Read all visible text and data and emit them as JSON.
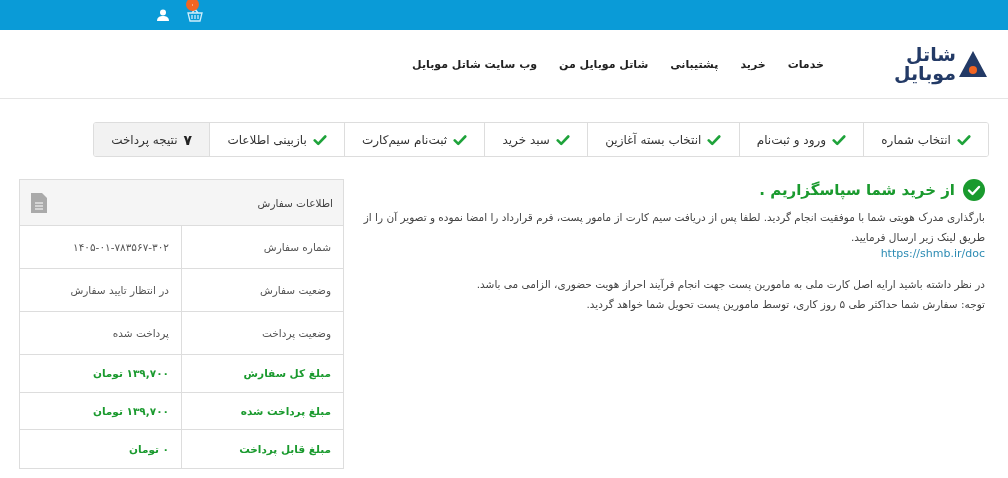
{
  "topbar": {
    "cart_count": "۰"
  },
  "header": {
    "logo": {
      "line_1": "شاتل",
      "line_2": "موبایل"
    },
    "nav": [
      "خدمات",
      "خرید",
      "پشتیبانی",
      "شاتل موبایل من",
      "وب سایت شاتل موبایل"
    ]
  },
  "steps": [
    {
      "label": "انتخاب شماره",
      "completed": true,
      "selected": false
    },
    {
      "label": "ورود و ثبت‌نام",
      "completed": true,
      "selected": false
    },
    {
      "label": "انتخاب بسته آغازین",
      "completed": true,
      "selected": false
    },
    {
      "label": "سبد خرید",
      "completed": true,
      "selected": false
    },
    {
      "label": "ثبت‌نام سیم‌کارت",
      "completed": true,
      "selected": false
    },
    {
      "label": "بازبینی اطلاعات",
      "completed": true,
      "selected": false
    },
    {
      "label": "نتیجه پرداخت",
      "number": "۷",
      "completed": false,
      "selected": true
    }
  ],
  "message": {
    "title": "از خرید شما سپاسگزاریم .",
    "paragraph_1": "بارگذاری مدرک هویتی شما با موفقیت انجام گردید. لطفا پس از دریافت سیم کارت از مامور پست، فرم قرارداد را امضا نموده و تصویر آن را از طریق لینک زیر ارسال فرمایید.",
    "link": "https://shmb.ir/doc",
    "paragraph_2": "در نظر داشته باشید ارایه اصل کارت ملی به مامورین پست جهت انجام فرآیند احراز هویت حضوری، الزامی می باشد.",
    "paragraph_3": "توجه: سفارش شما حداکثر طی ۵ روز کاری، توسط مامورین پست تحویل شما خواهد گردید."
  },
  "order_info": {
    "title": "اطلاعات سفارش",
    "rows": [
      {
        "label": "شماره سفارش",
        "value": "۱۴۰۵-۰۱-۷۸۳۵۶۷-۳۰۲",
        "highlighted": false
      },
      {
        "label": "وضعیت سفارش",
        "value": "در انتظار تایید سفارش",
        "highlighted": false
      },
      {
        "label": "وضعیت پرداخت",
        "value": "پرداخت شده",
        "highlighted": false
      },
      {
        "label": "مبلغ کل سفارش",
        "value": "۱۳۹,۷۰۰ تومان",
        "highlighted": true
      },
      {
        "label": "مبلغ پرداخت شده",
        "value": "۱۳۹,۷۰۰ تومان",
        "highlighted": true
      },
      {
        "label": "مبلغ قابل پرداخت",
        "value": "۰ تومان",
        "highlighted": true
      }
    ]
  }
}
